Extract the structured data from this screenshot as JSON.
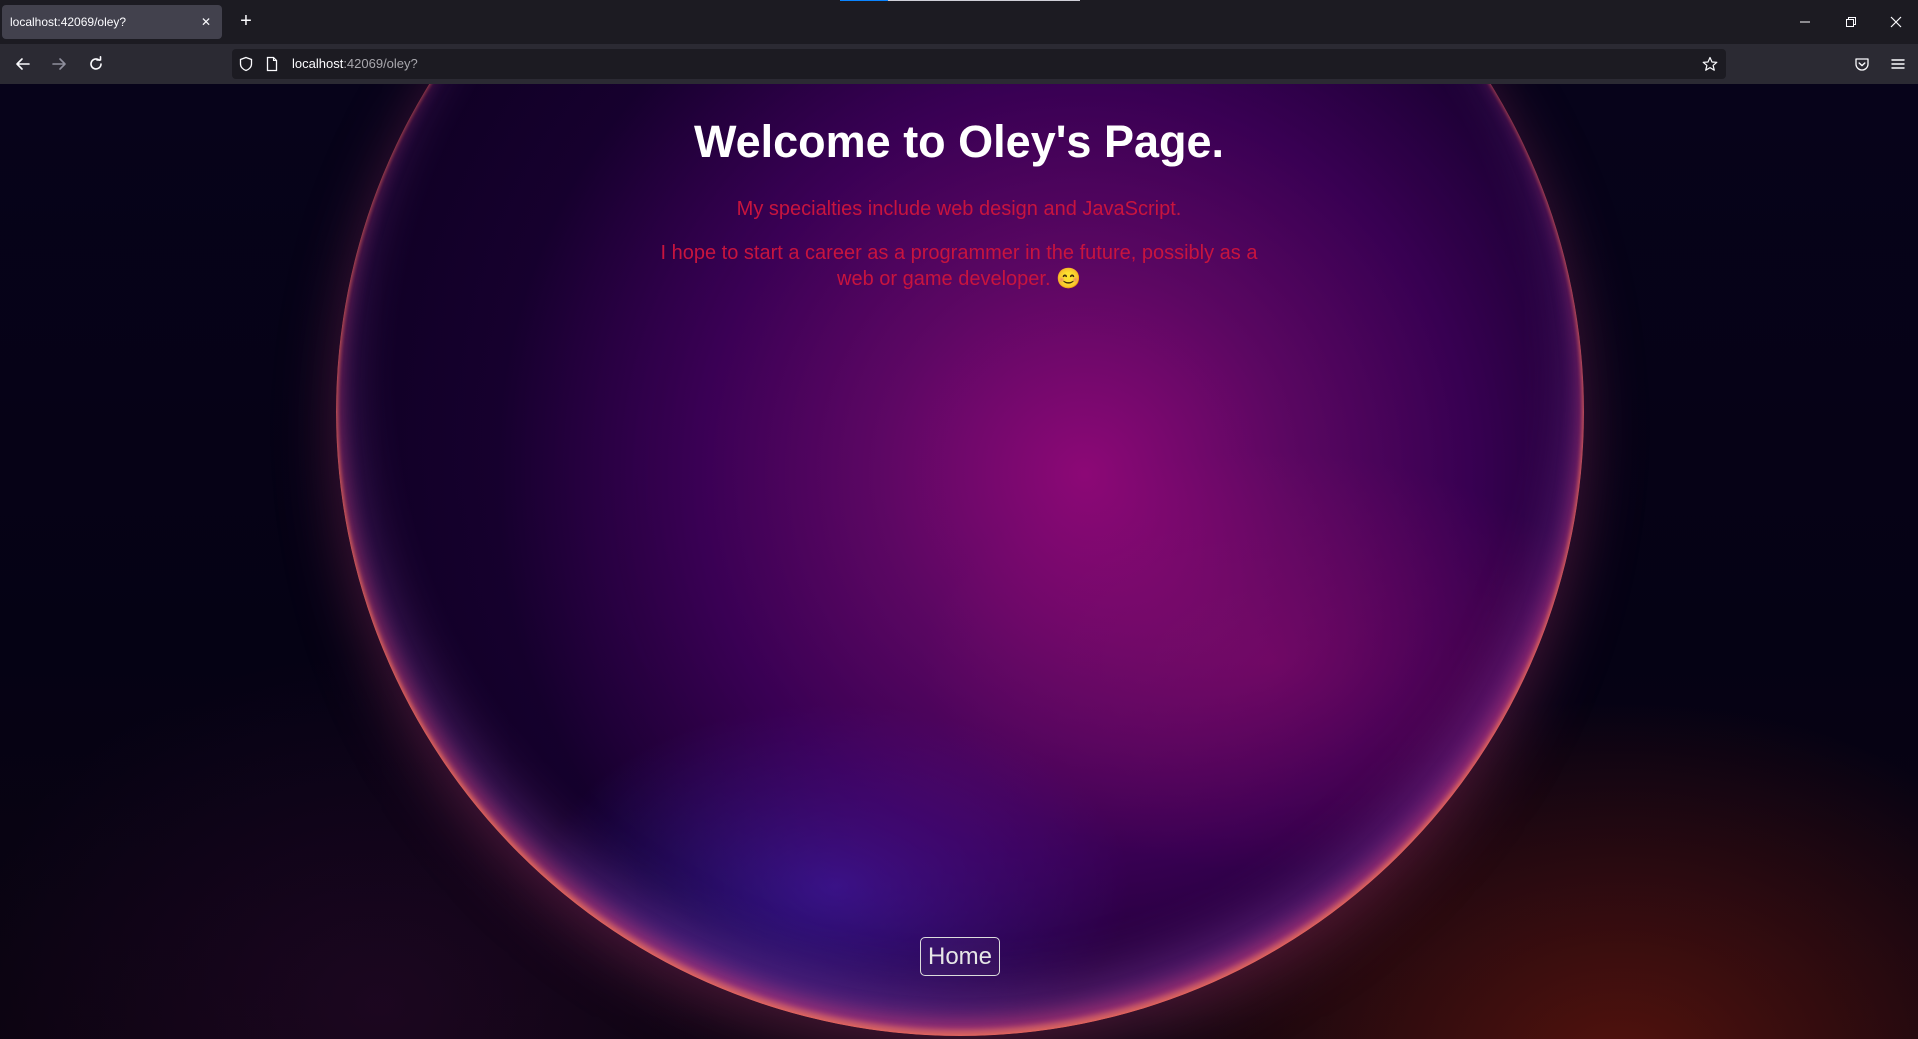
{
  "browser": {
    "tab_title": "localhost:42069/oley?",
    "tab_close_glyph": "✕",
    "new_tab_glyph": "+",
    "url_host": "localhost",
    "url_path": ":42069/oley?"
  },
  "icons": {
    "back": "arrow-left-icon",
    "forward": "arrow-right-icon",
    "reload": "reload-icon",
    "shield": "shield-icon",
    "page": "page-icon",
    "bookmark": "star-icon",
    "pocket": "pocket-icon",
    "menu": "hamburger-menu-icon",
    "minimize": "minimize-icon",
    "restore": "restore-icon",
    "close": "close-icon"
  },
  "page": {
    "title": "Welcome to Oley's Page.",
    "specialties": "My specialties include web design and JavaScript.",
    "career": "I hope to start a career as a programmer in the future, possibly as a web or game developer. 😊",
    "home_button": "Home"
  },
  "colors": {
    "title": "#ffffff",
    "body_text": "#c8143e",
    "chrome_dark": "#1c1b22",
    "chrome_nav": "#2b2a33",
    "tab_active": "#42414d"
  }
}
